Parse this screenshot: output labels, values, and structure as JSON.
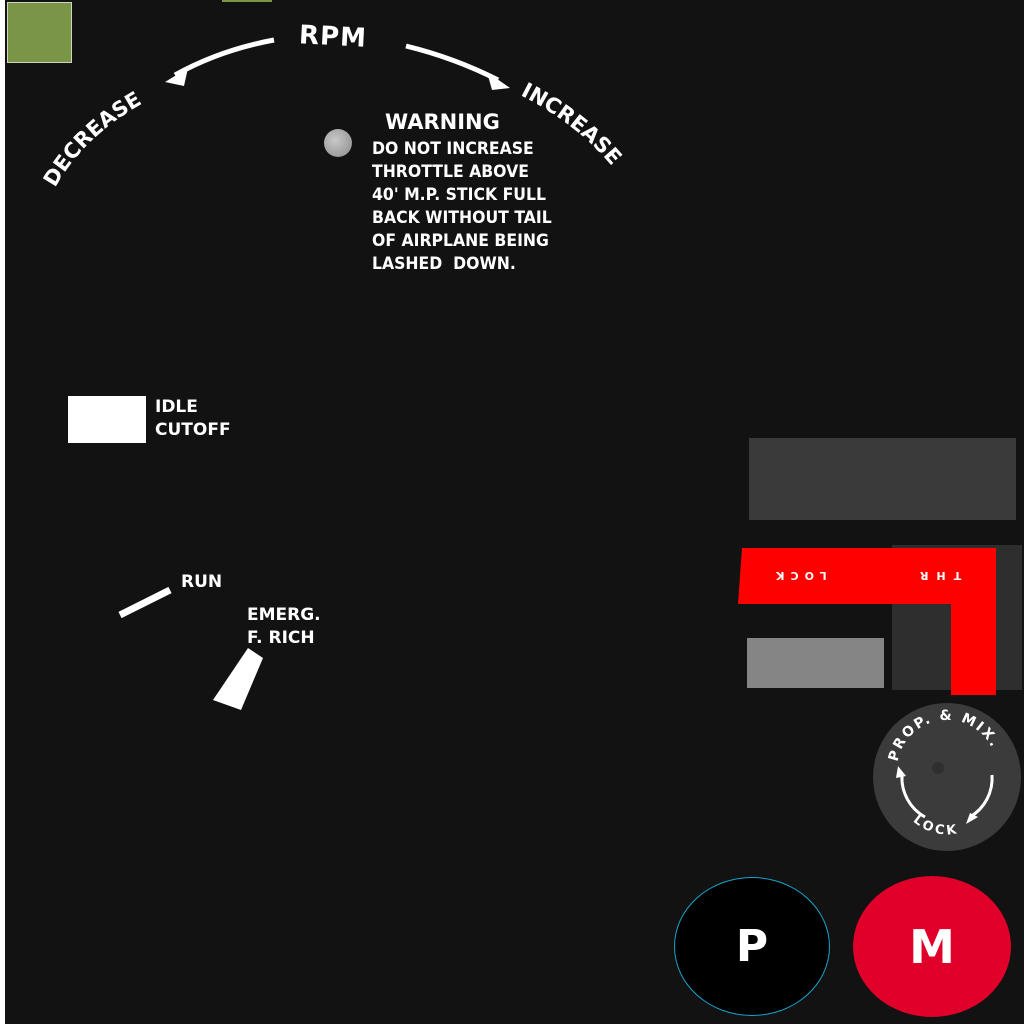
{
  "panel": {
    "rpm": {
      "title": "RPM",
      "decrease": "DECREASE",
      "increase": "INCREASE"
    },
    "warning": {
      "title": "WARNING",
      "lines": "DO NOT INCREASE\nTHROTTLE ABOVE\n40' M.P. STICK FULL\nBACK WITHOUT TAIL\nOF AIRPLANE BEING\nLASHED  DOWN."
    },
    "idle_cutoff": "IDLE\nCUTOFF",
    "run": "RUN",
    "emerg_f_rich": "EMERG.\nF. RICH",
    "throttle_lock": {
      "lock": "LOCK",
      "thr": "THR"
    },
    "prop_mix_lock": {
      "top": "PROP. & MIX.",
      "bottom": "LOCK"
    },
    "buttons": {
      "p": "P",
      "m": "M"
    }
  },
  "colors": {
    "panel_bg": "#121212",
    "lock_red": "#ff0000",
    "m_button": "#e0002a",
    "p_ring": "#19a3c9",
    "swatch": "#7a9548"
  }
}
